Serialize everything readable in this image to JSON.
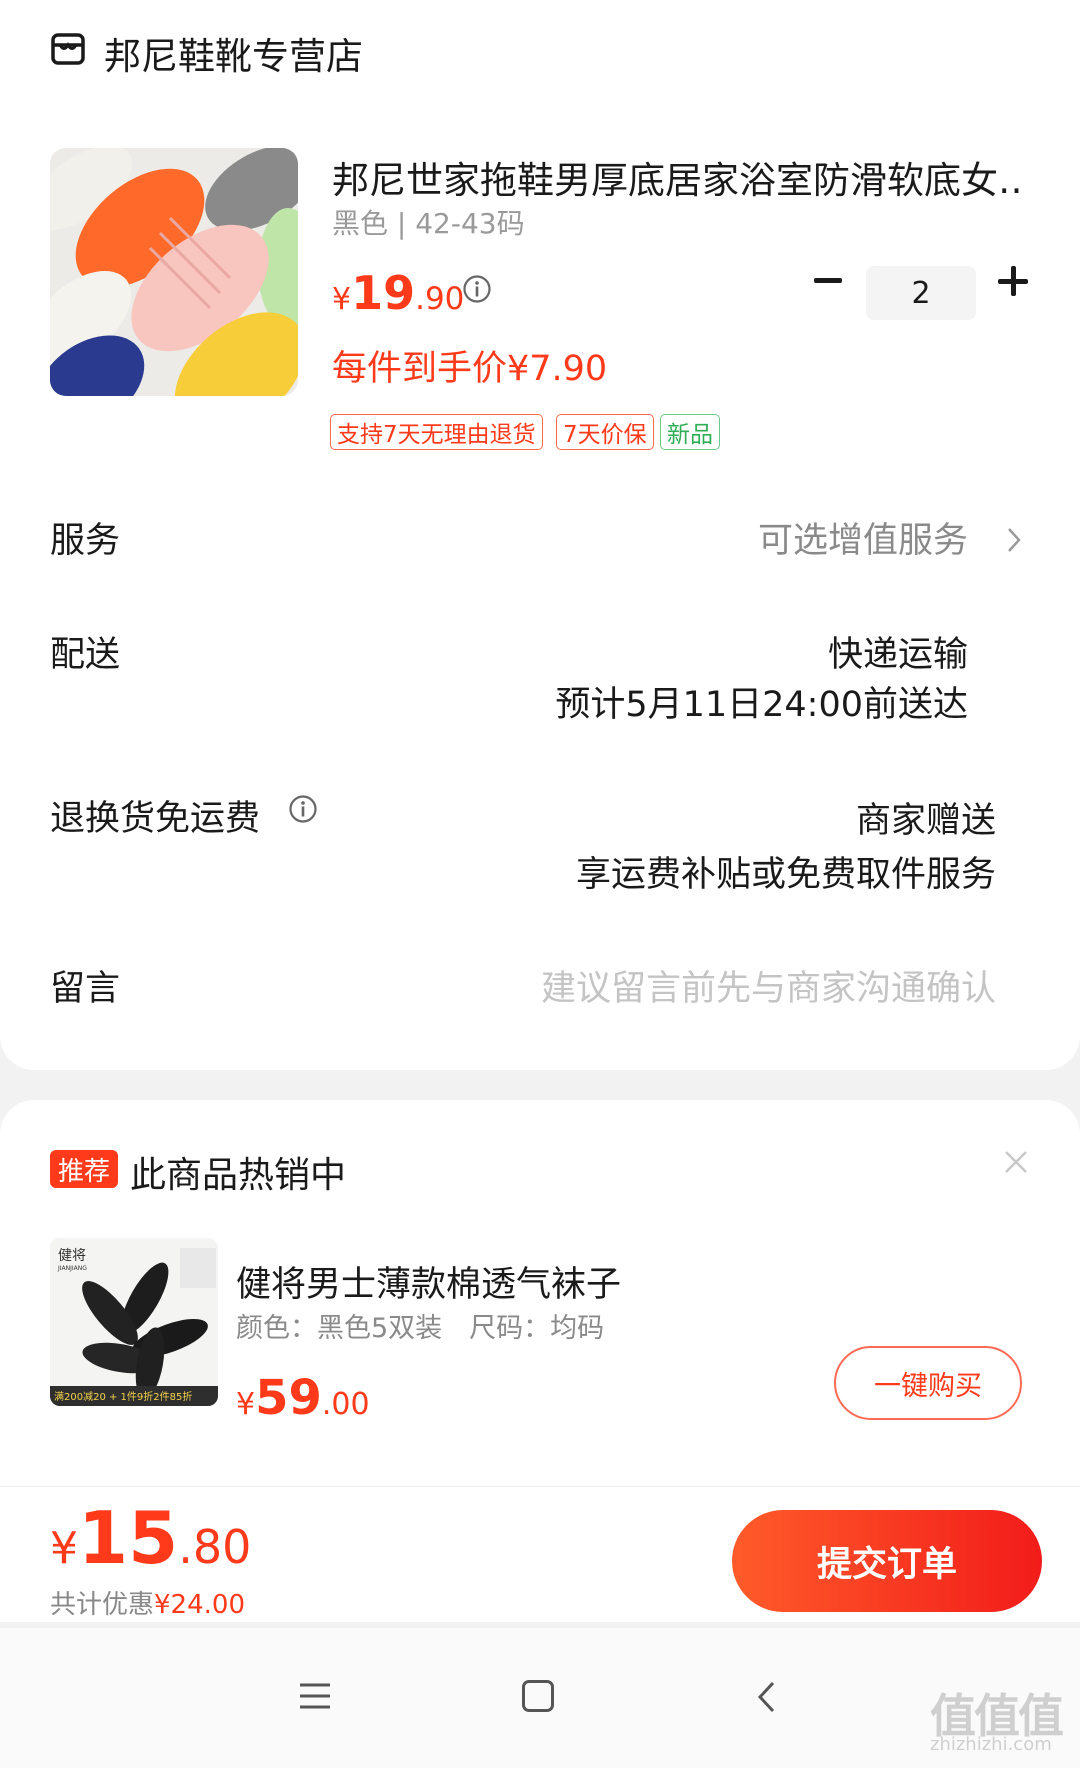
{
  "shop": {
    "icon": "shop-icon",
    "name": "邦尼鞋靴专营店"
  },
  "product": {
    "title": "邦尼世家拖鞋男厚底居家浴室防滑软底女…",
    "spec": "黑色 | 42-43码",
    "price_symbol": "¥",
    "price_int": "19",
    "price_dec": ".90",
    "quantity": "2",
    "deal_price": "每件到手价¥7.90",
    "tags": [
      "支持7天无理由退货",
      "7天价保",
      "新品"
    ]
  },
  "rows": {
    "service_label": "服务",
    "service_value": "可选增值服务",
    "delivery_label": "配送",
    "delivery_method": "快递运输",
    "delivery_eta": "预计5月11日24:00前送达",
    "return_label": "退换货免运费",
    "return_value1": "商家赠送",
    "return_value2": "享运费补贴或免费取件服务",
    "note_label": "留言",
    "note_placeholder": "建议留言前先与商家沟通确认"
  },
  "recommend": {
    "badge": "推荐",
    "title": "此商品热销中",
    "item_title": "健将男士薄款棉透气袜子",
    "item_spec": "颜色：黑色5双装　尺码：均码",
    "price_symbol": "¥",
    "price_int": "59",
    "price_dec": ".00",
    "buy_label": "一键购买",
    "thumb_brand": "健将",
    "thumb_brand_en": "JIANJIANG",
    "thumb_promo": "满200减20 + 1件9折2件85折"
  },
  "footer": {
    "total_symbol": "¥",
    "total_int": "15",
    "total_dec": ".80",
    "saving_label": "共计优惠",
    "saving_value": "¥24.00",
    "submit_label": "提交订单"
  },
  "watermark": {
    "main": "值值值",
    "sub": "zhizhizhi.com"
  },
  "colors": {
    "accent": "#ff3a1a",
    "green": "#2fae57"
  }
}
